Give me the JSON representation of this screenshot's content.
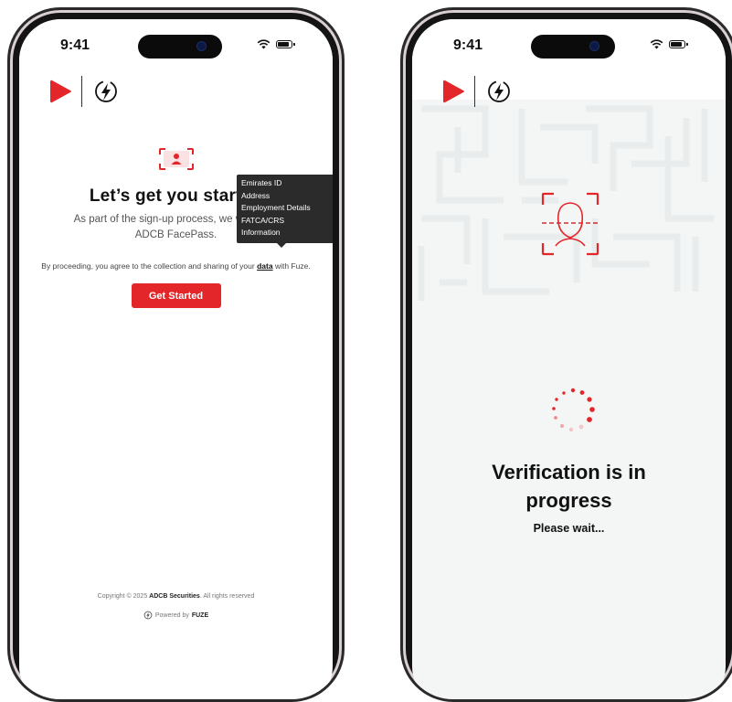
{
  "colors": {
    "brand_red": "#e3262a",
    "tooltip_bg": "#2b2b2b",
    "text_dark": "#111111"
  },
  "status_bar": {
    "time": "9:41",
    "icons": [
      "wifi-icon",
      "battery-icon"
    ]
  },
  "logos": [
    "adcb-play-logo",
    "fuze-bolt-logo"
  ],
  "onboarding": {
    "icon": "id-card-icon",
    "title": "Let’s get you started",
    "subtitle_line1": "As part of the sign-up process, we will verify",
    "subtitle_line2": "ADCB FacePass.",
    "consent_prefix": "By proceeding, you agree to the collection and sharing of your",
    "consent_link": "data",
    "consent_suffix": "with Fuze.",
    "button": "Get Started",
    "tooltip_items": [
      "Emirates ID",
      "Address",
      "Employment Details",
      "FATCA/CRS",
      "Information"
    ],
    "footer_prefix": "Copyright © 2025",
    "footer_brand": "ADCB Securities",
    "footer_suffix": ". All rights reserved",
    "powered_prefix": "Powered by",
    "powered_brand": "FUZE"
  },
  "verification": {
    "icon": "face-scan-icon",
    "spinner": "loading-spinner-icon",
    "title_line1": "Verification is in",
    "title_line2": "progress",
    "subtitle": "Please wait..."
  }
}
